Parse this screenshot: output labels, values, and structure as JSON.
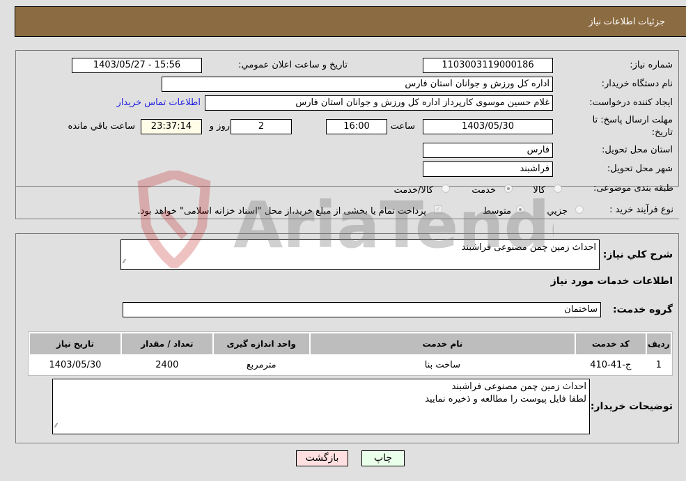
{
  "header": {
    "title": "جزئیات اطلاعات نیاز"
  },
  "details": {
    "need_number_label": "شماره نیاز:",
    "need_number": "1103003119000186",
    "announce_label": "تاریخ و ساعت اعلان عمومي:",
    "announce_value": "1403/05/27 - 15:56",
    "buyer_org_label": "نام دستگاه خریدار:",
    "buyer_org": "اداره کل ورزش و جوانان استان فارس",
    "creator_label": "ایجاد کننده درخواست:",
    "creator": "غلام حسین موسوی کارپرداز اداره کل ورزش و جوانان استان فارس",
    "contact_link": "اطلاعات تماس خریدار",
    "deadline_label_1": "مهلت ارسال پاسخ: تا",
    "deadline_label_2": "تاریخ:",
    "deadline_date": "1403/05/30",
    "time_label": "ساعت",
    "deadline_time": "16:00",
    "days_value": "2",
    "days_label": "روز و",
    "remaining_time": "23:37:14",
    "remaining_label": "ساعت باقي مانده",
    "province_label": "استان محل تحویل:",
    "province": "فارس",
    "city_label": "شهر محل تحویل:",
    "city": "فراشبند",
    "category_label": "طبقه بندی موضوعی:",
    "category_options": [
      {
        "label": "کالا",
        "selected": false
      },
      {
        "label": "خدمت",
        "selected": true
      },
      {
        "label": "کالا/خدمت",
        "selected": false
      }
    ],
    "process_label": "نوع فرآیند خرید :",
    "process_options": [
      {
        "label": "جزيي",
        "selected": false
      },
      {
        "label": "متوسط",
        "selected": true
      }
    ],
    "payment_note": "پرداخت تمام یا بخشی از مبلغ خرید،از محل \"اسناد خزانه اسلامی\" خواهد بود.",
    "payment_checked": true
  },
  "services": {
    "description_label": "شرح کلي نیاز:",
    "description": "احداث زمین چمن مصنوعی فراشبند",
    "section_title": "اطلاعات خدمات مورد نیاز",
    "group_label": "گروه خدمت:",
    "group_value": "ساختمان",
    "table": {
      "headers": [
        "ردیف",
        "کد خدمت",
        "نام خدمت",
        "واحد اندازه گیری",
        "تعداد / مقدار",
        "تاریخ نیاز"
      ],
      "rows": [
        [
          "1",
          "ج-41-410",
          "ساخت بنا",
          "مترمربع",
          "2400",
          "1403/05/30"
        ]
      ]
    },
    "buyer_notes_label": "توضیحات خریدار:",
    "buyer_notes_line1": "احداث زمین چمن مصنوعی فراشبند",
    "buyer_notes_line2": "لطفا فایل پیوست را مطالعه و ذخیره نمایید"
  },
  "buttons": {
    "print": "چاپ",
    "back": "بازگشت"
  },
  "watermark": {
    "text": "AriaTender.neT"
  },
  "colors": {
    "header_bg": "#8b6b41",
    "link": "#2020e0",
    "print_bg": "#eaffea",
    "back_bg": "#ffe0e0"
  }
}
